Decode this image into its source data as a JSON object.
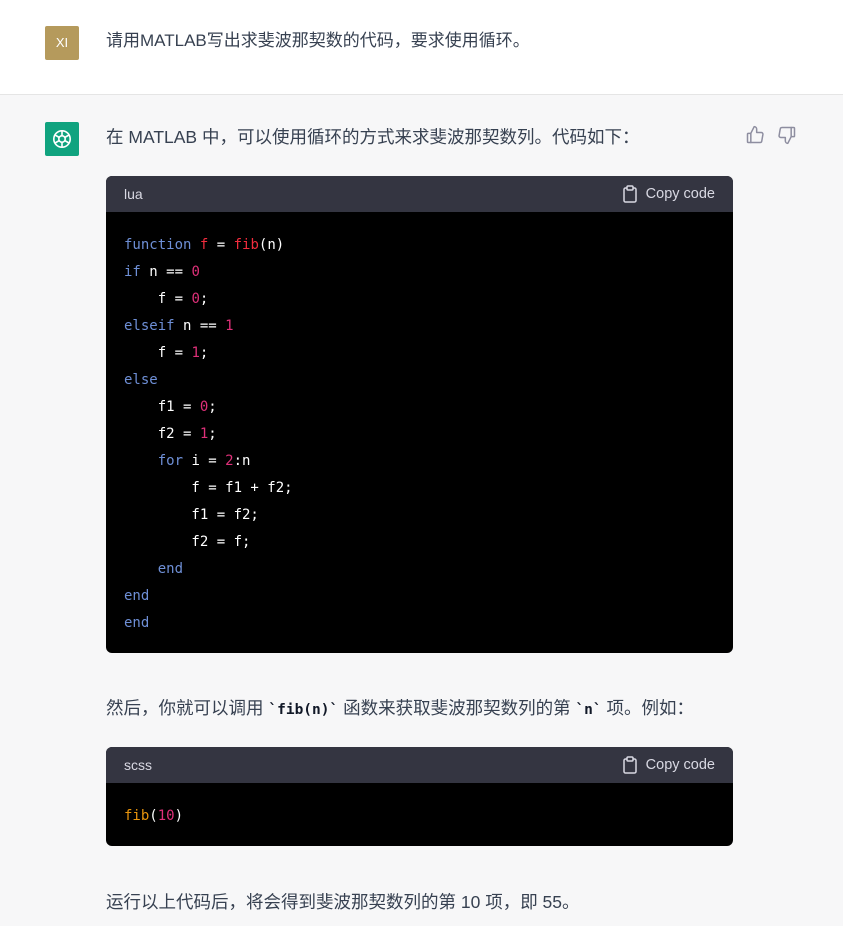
{
  "user": {
    "avatar_initials": "XI",
    "avatar_color": "#b59a5c",
    "message": "请用MATLAB写出求斐波那契数的代码，要求使用循环。"
  },
  "assistant": {
    "avatar_color": "#10a37f",
    "intro": "在 MATLAB 中，可以使用循环的方式来求斐波那契数列。代码如下：",
    "code1": {
      "language": "lua",
      "copy_label": "Copy code"
    },
    "para2_before": "然后，你就可以调用 ",
    "para2_code1": "`fib(n)`",
    "para2_mid": " 函数来获取斐波那契数列的第 ",
    "para2_code2": "`n`",
    "para2_after": " 项。例如：",
    "code2": {
      "language": "scss",
      "copy_label": "Copy code"
    },
    "conclusion": "运行以上代码后，将会得到斐波那契数列的第 10 项，即 55。"
  },
  "icons": {
    "thumbs_up": "thumbs-up-icon",
    "thumbs_down": "thumbs-down-icon",
    "clipboard": "clipboard-icon",
    "openai_logo": "openai-logo-icon"
  }
}
